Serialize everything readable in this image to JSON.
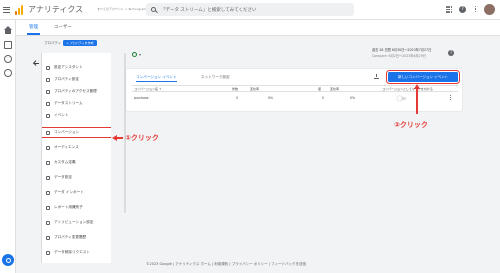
{
  "header": {
    "app_name": "アナリティクス",
    "account_path": "すべてのアカウント > Techcogram",
    "account_name": "",
    "search_placeholder": "「データ ストリーム」と検索してみてください",
    "icons": [
      "menu-icon",
      "analytics-logo",
      "search-icon",
      "apps-icon",
      "help-icon",
      "more-vert-icon",
      "avatar"
    ]
  },
  "tabs": {
    "admin": "管理",
    "user": "ユーザー"
  },
  "property": {
    "label": "プロパティ",
    "create_button": "+ プロパティを作成"
  },
  "nav": {
    "items": [
      {
        "label": "設定アシスタント",
        "icon": "checklist-icon"
      },
      {
        "label": "プロパティ設定",
        "icon": "property-icon"
      },
      {
        "label": "プロパティのアクセス管理",
        "icon": "people-icon"
      },
      {
        "label": "データストリーム",
        "icon": "stream-icon"
      },
      {
        "label": "イベント",
        "icon": "event-icon"
      },
      {
        "label": "コンバージョン",
        "icon": "flag-icon"
      },
      {
        "label": "オーディエンス",
        "icon": "audience-icon"
      },
      {
        "label": "カスタム定義",
        "icon": "custom-icon"
      },
      {
        "label": "データ設定",
        "icon": "data-icon"
      },
      {
        "label": "データ インポート",
        "icon": "import-icon"
      },
      {
        "label": "レポート用識別子",
        "icon": "id-icon"
      },
      {
        "label": "アトリビューション設定",
        "icon": "attribution-icon"
      },
      {
        "label": "プロパティ変更履歴",
        "icon": "history-icon"
      },
      {
        "label": "データ削除リクエスト",
        "icon": "delete-icon"
      }
    ]
  },
  "annotations": {
    "click1": "①クリック",
    "click2": "②クリック",
    "color": "#e53935"
  },
  "date_range": {
    "label": "過去 28 日間",
    "range": "6月30日〜2023年7月27日",
    "compare": "Compare: 6月2日〜2023年6月29日"
  },
  "card": {
    "tab_conversions": "コンバージョン イベント",
    "tab_network": "ネットワーク設定",
    "new_button": "新しいコンバージョン イベント",
    "columns": [
      "コンバージョン名 ↑",
      "件数",
      "変化率",
      "値",
      "変化率",
      "コンバージョンとしてマークを付ける"
    ],
    "rows": [
      {
        "name": "purchase",
        "count": "0",
        "count_change": "0%",
        "value": "0",
        "value_change": "0%",
        "marked": true
      }
    ]
  },
  "footer": "©2023 Google | アナリティクス ホーム | 利用規約 | プライバシー ポリシー | フィードバックを送信",
  "colors": {
    "accent": "#1a73e8",
    "highlight": "#e53935"
  }
}
